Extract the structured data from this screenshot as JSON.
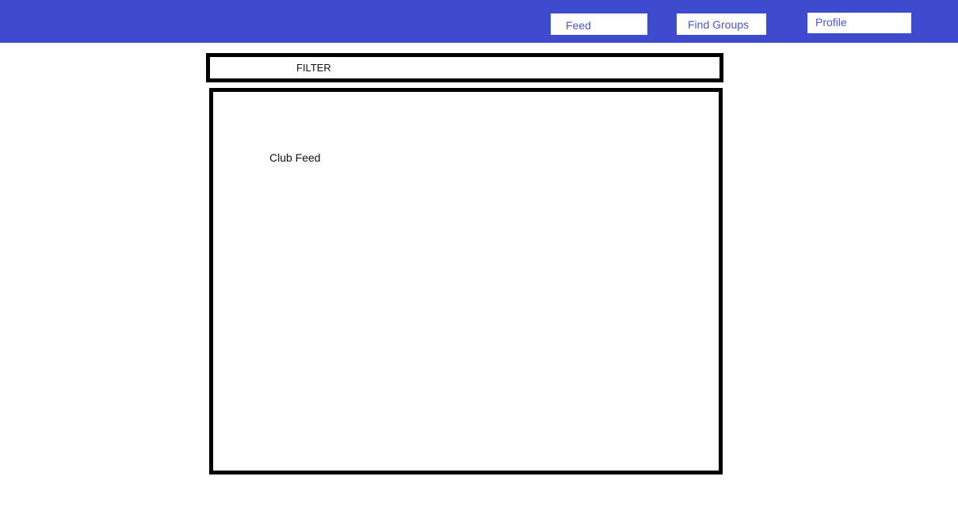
{
  "nav": {
    "feed_label": "Feed",
    "find_groups_label": "Find Groups",
    "profile_label": "Profile"
  },
  "filter": {
    "label": "FILTER"
  },
  "feed": {
    "title": "Club Feed"
  },
  "colors": {
    "top_bar": "#3f4bcf",
    "nav_text": "#4a55d0",
    "border": "#000000",
    "background": "#ffffff"
  }
}
